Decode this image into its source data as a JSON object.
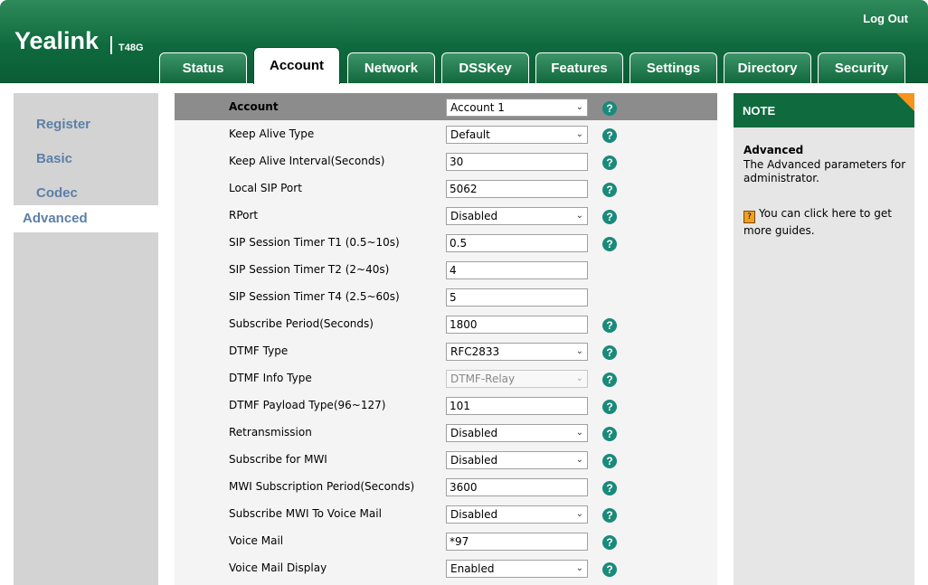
{
  "header": {
    "logo": "Yealink",
    "model": "T48G",
    "logout_label": "Log Out"
  },
  "tabs": [
    {
      "label": "Status"
    },
    {
      "label": "Account"
    },
    {
      "label": "Network"
    },
    {
      "label": "DSSKey"
    },
    {
      "label": "Features"
    },
    {
      "label": "Settings"
    },
    {
      "label": "Directory"
    },
    {
      "label": "Security"
    }
  ],
  "active_tab": "Account",
  "sidebar": {
    "items": [
      {
        "label": "Register"
      },
      {
        "label": "Basic"
      },
      {
        "label": "Codec"
      },
      {
        "label": "Advanced"
      }
    ],
    "active": "Advanced"
  },
  "form": {
    "account": {
      "label": "Account",
      "value": "Account 1"
    },
    "rows": [
      {
        "label": "Keep Alive Type",
        "value": "Default"
      },
      {
        "label": "Keep Alive Interval(Seconds)",
        "value": "30"
      },
      {
        "label": "Local SIP Port",
        "value": "5062"
      },
      {
        "label": "RPort",
        "value": "Disabled"
      },
      {
        "label": "SIP Session Timer T1 (0.5~10s)",
        "value": "0.5"
      },
      {
        "label": "SIP Session Timer T2 (2~40s)",
        "value": "4"
      },
      {
        "label": "SIP Session Timer T4 (2.5~60s)",
        "value": "5"
      },
      {
        "label": "Subscribe Period(Seconds)",
        "value": "1800"
      },
      {
        "label": "DTMF Type",
        "value": "RFC2833"
      },
      {
        "label": "DTMF Info Type",
        "value": "DTMF-Relay"
      },
      {
        "label": "DTMF Payload Type(96~127)",
        "value": "101"
      },
      {
        "label": "Retransmission",
        "value": "Disabled"
      },
      {
        "label": "Subscribe for MWI",
        "value": "Disabled"
      },
      {
        "label": "MWI Subscription Period(Seconds)",
        "value": "3600"
      },
      {
        "label": "Subscribe MWI To Voice Mail",
        "value": "Disabled"
      },
      {
        "label": "Voice Mail",
        "value": "*97"
      },
      {
        "label": "Voice Mail Display",
        "value": "Enabled"
      }
    ]
  },
  "help_glyph": "?",
  "dropdown_glyph": "⌄",
  "note": {
    "title": "NOTE",
    "heading": "Advanced",
    "text": "The Advanced parameters for administrator.",
    "guide": "You can click here to get more guides.",
    "guide_icon": "?"
  },
  "colors": {
    "brand_green": "#0f6a3e",
    "tab_gradient_top": "#3c9468",
    "sidebar_link": "#5c7fa8",
    "help_icon": "#1a8a7a",
    "note_corner": "#f7941d"
  }
}
